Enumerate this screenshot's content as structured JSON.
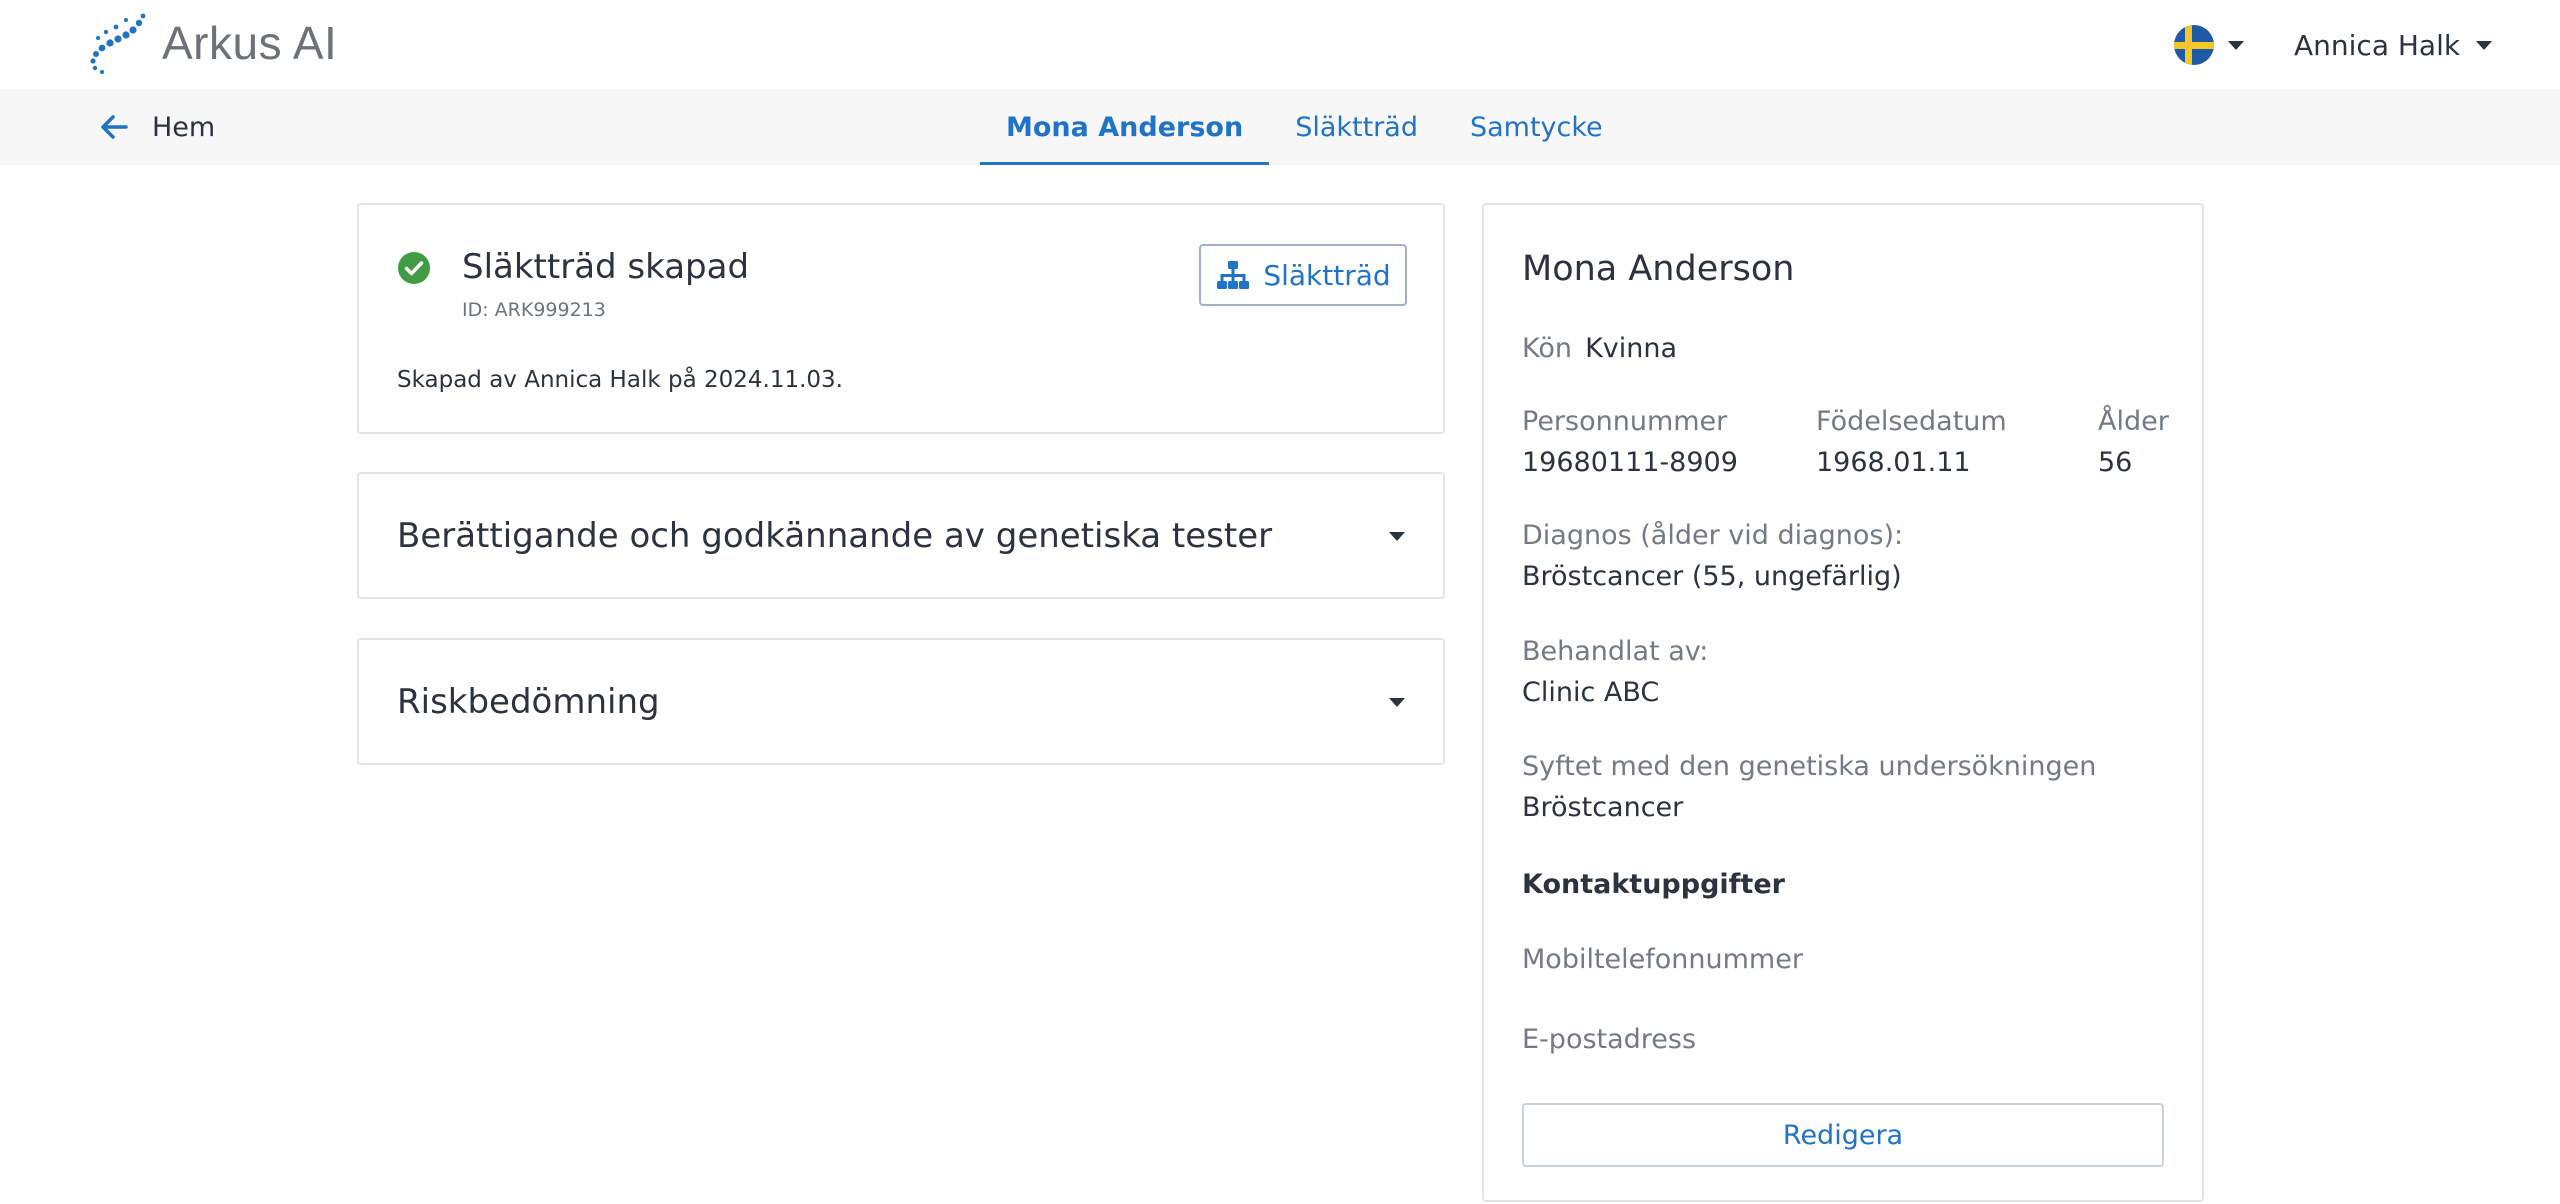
{
  "header": {
    "brand_name": "Arkus AI",
    "language_flag": "sweden-flag-icon",
    "user_name": "Annica Halk"
  },
  "nav": {
    "back_label": "Hem",
    "tabs": [
      {
        "label": "Mona Anderson",
        "active": true
      },
      {
        "label": "Släktträd",
        "active": false
      },
      {
        "label": "Samtycke",
        "active": false
      }
    ]
  },
  "status_card": {
    "title": "Släktträd skapad",
    "id_text": "ID: ARK999213",
    "button_label": "Släktträd",
    "created_text": "Skapad av Annica Halk på 2024.11.03."
  },
  "accordions": [
    {
      "title": "Berättigande och godkännande av genetiska tester"
    },
    {
      "title": "Riskbedömning"
    }
  ],
  "patient": {
    "name": "Mona Anderson",
    "gender_label": "Kön",
    "gender_value": "Kvinna",
    "pnr_label": "Personnummer",
    "pnr_value": "19680111-8909",
    "dob_label": "Födelsedatum",
    "dob_value": "1968.01.11",
    "age_label": "Ålder",
    "age_value": "56",
    "diagnosis_label": "Diagnos (ålder vid diagnos):",
    "diagnosis_value": "Bröstcancer (55, ungefärlig)",
    "treated_label": "Behandlat av:",
    "treated_value": "Clinic ABC",
    "purpose_label": "Syftet med den genetiska undersökningen",
    "purpose_value": "Bröstcancer",
    "contact_heading": "Kontaktuppgifter",
    "mobile_label": "Mobiltelefonnummer",
    "email_label": "E-postadress",
    "edit_label": "Redigera"
  },
  "colors": {
    "accent": "#1f73c9",
    "success": "#3f9c45",
    "border": "#e1e5ea",
    "navbar_bg": "#f7f7f8"
  }
}
